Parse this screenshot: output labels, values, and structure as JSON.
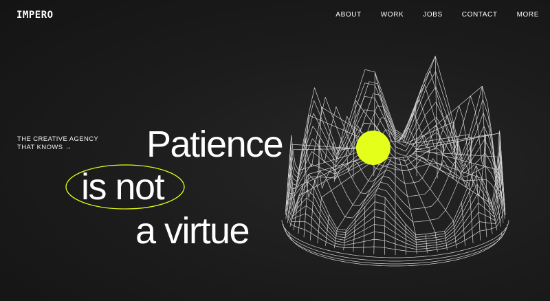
{
  "brand": {
    "name": "IMPERO"
  },
  "nav": {
    "items": [
      {
        "label": "ABOUT"
      },
      {
        "label": "WORK"
      },
      {
        "label": "JOBS"
      },
      {
        "label": "CONTACT"
      },
      {
        "label": "MORE"
      }
    ]
  },
  "hero": {
    "tagline_line1": "THE CREATIVE AGENCY",
    "tagline_line2": "THAT KNOWS →",
    "headline_line1": "Patience",
    "headline_line2": "is not",
    "headline_line3": "a virtue"
  },
  "colors": {
    "background": "#1c1c1c",
    "text": "#ffffff",
    "accent": "#e4ff1a",
    "wireframe": "#d9d9d9"
  }
}
